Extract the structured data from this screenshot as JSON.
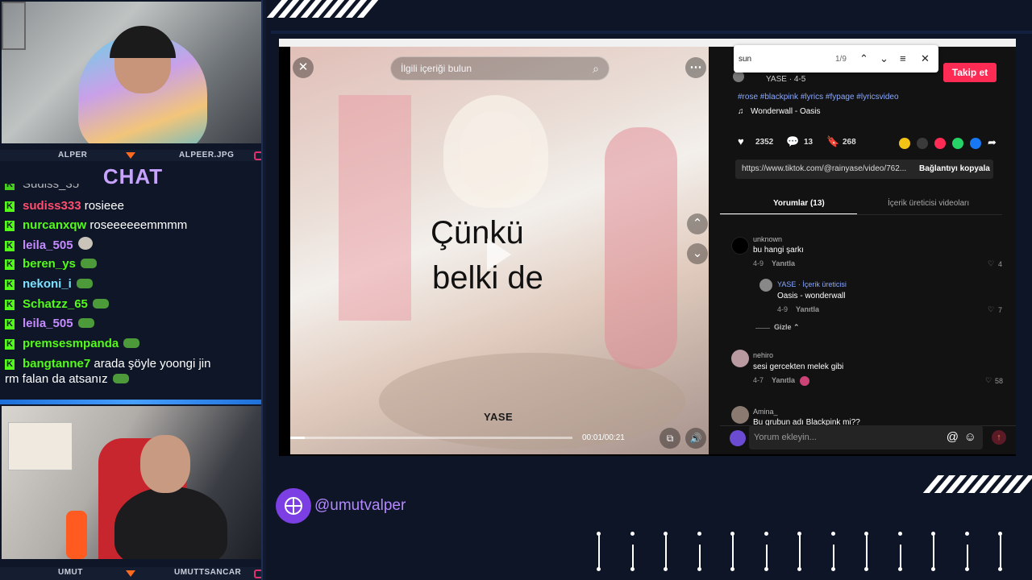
{
  "stream": {
    "top_cam_labels": {
      "left": "ALPER",
      "right": "ALPEER.JPG"
    },
    "bottom_cam_labels": {
      "left": "UMUT",
      "right": "UMUTTSANCAR"
    },
    "chat_title": "CHAT",
    "chat_partial_top": "Sudiss_35",
    "handle": "@umutvalper",
    "messages": [
      {
        "user": "sudiss333",
        "color": "#ff4d6d",
        "text": "rosieee",
        "emote": ""
      },
      {
        "user": "nurcanxqw",
        "color": "#53fc18",
        "text": "roseeeeeemmmm",
        "emote": ""
      },
      {
        "user": "leila_505",
        "color": "#c58bff",
        "text": "",
        "emote": "cat"
      },
      {
        "user": "beren_ys",
        "color": "#53fc18",
        "text": "",
        "emote": "frog"
      },
      {
        "user": "nekoni_i",
        "color": "#7ee0ff",
        "text": "",
        "emote": "frog"
      },
      {
        "user": "Schatzz_65",
        "color": "#53fc18",
        "text": "",
        "emote": "frog"
      },
      {
        "user": "leila_505",
        "color": "#c58bff",
        "text": "",
        "emote": "frog"
      },
      {
        "user": "premsesmpanda",
        "color": "#53fc18",
        "text": "",
        "emote": "frog"
      },
      {
        "user": "bangtanne7",
        "color": "#53fc18",
        "text": "arada şöyle yoongi jin",
        "emote": ""
      }
    ],
    "message_wrap_line": "rm falan da atsanız"
  },
  "video": {
    "search_placeholder": "İlgili içeriği bulun",
    "lyric_line1": "Çünkü",
    "lyric_line2": "belki de",
    "watermark": "YASE",
    "time": "00:01/00:21",
    "close_icon": "close-icon",
    "progress_fraction": 0.05
  },
  "find_bar": {
    "query": "sun",
    "count": "1/9"
  },
  "post": {
    "author_line": "YASE · 4-5",
    "follow_label": "Takip et",
    "hashtags": "#rose #blackpink #lyrics #fypage #lyricsvideo",
    "sound": "Wonderwall - Oasis",
    "likes": "2352",
    "comments": "13",
    "saves": "268",
    "url": "https://www.tiktok.com/@rainyase/video/762...",
    "copy_link_label": "Bağlantıyı kopyala",
    "tab_comments": "Yorumlar (13)",
    "tab_creator": "İçerik üreticisi videoları",
    "input_placeholder": "Yorum ekleyin..."
  },
  "comments": [
    {
      "user": "unknown",
      "text": "bu hangi şarkı",
      "date": "4-9",
      "reply": "Yanıtla",
      "likes": "4"
    },
    {
      "user": "YASE · İçerik üreticisi",
      "text": "Oasis - wonderwall",
      "date": "4-9",
      "reply": "Yanıtla",
      "likes": "7"
    },
    {
      "user": "nehiro",
      "text": "sesi gercekten melek gibi",
      "date": "4-7",
      "reply": "Yanıtla",
      "likes": "58"
    },
    {
      "user": "Amina_",
      "text": "Bu grubun adı Blackpink mi??",
      "date": "",
      "reply": "",
      "likes": ""
    }
  ],
  "hide_label": "Gizle"
}
